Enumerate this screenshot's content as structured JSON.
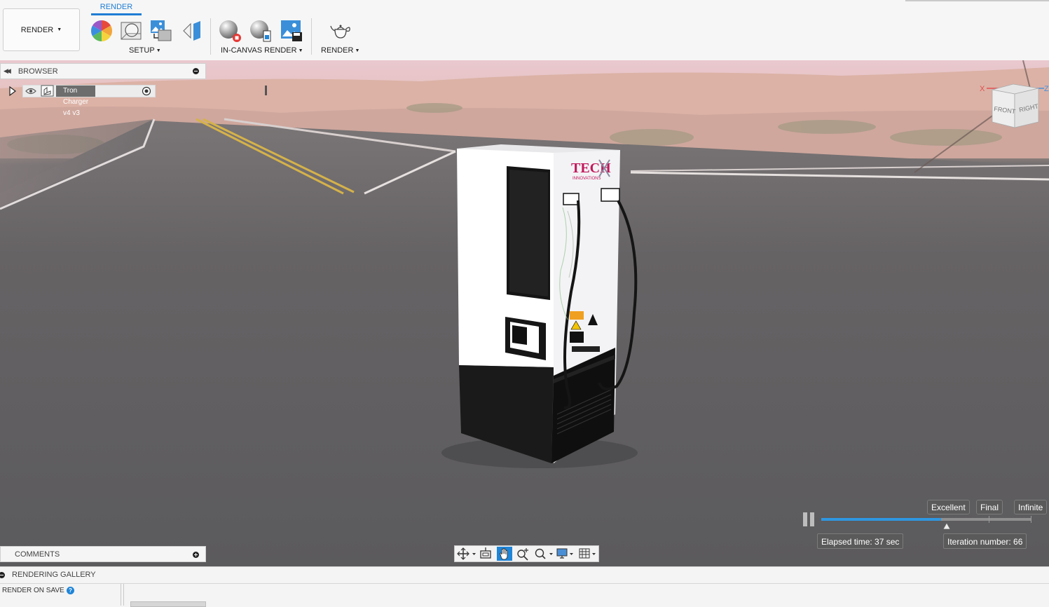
{
  "toolbar": {
    "workspace_label": "RENDER",
    "active_tab": "RENDER",
    "groups": {
      "setup": "SETUP",
      "in_canvas_render": "IN-CANVAS RENDER",
      "render": "RENDER"
    },
    "icons": [
      "appearance-icon",
      "scene-settings-icon",
      "texture-map-icon",
      "decal-icon",
      "in-canvas-render-icon",
      "in-canvas-render-settings-icon",
      "capture-image-icon",
      "render-teapot-icon"
    ]
  },
  "browser": {
    "title": "BROWSER",
    "root_item": "Tron Charger v4 v3"
  },
  "viewcube": {
    "face_front": "FRONT",
    "face_right": "RIGHT",
    "axis_x": "X",
    "axis_z": "Z"
  },
  "scene": {
    "charger_brand_text": "TECH",
    "charger_brand_sub": "INNOVATIONS"
  },
  "render_progress": {
    "progress_fraction": 0.57,
    "quality_levels": [
      "Excellent",
      "Final",
      "Infinite"
    ],
    "elapsed": "Elapsed time: 37 sec",
    "iteration": "Iteration number: 66",
    "accent_color": "#2f97e0"
  },
  "comments": {
    "title": "COMMENTS"
  },
  "gallery": {
    "title": "RENDERING GALLERY",
    "render_on_save": "RENDER ON SAVE",
    "help_glyph": "?"
  }
}
